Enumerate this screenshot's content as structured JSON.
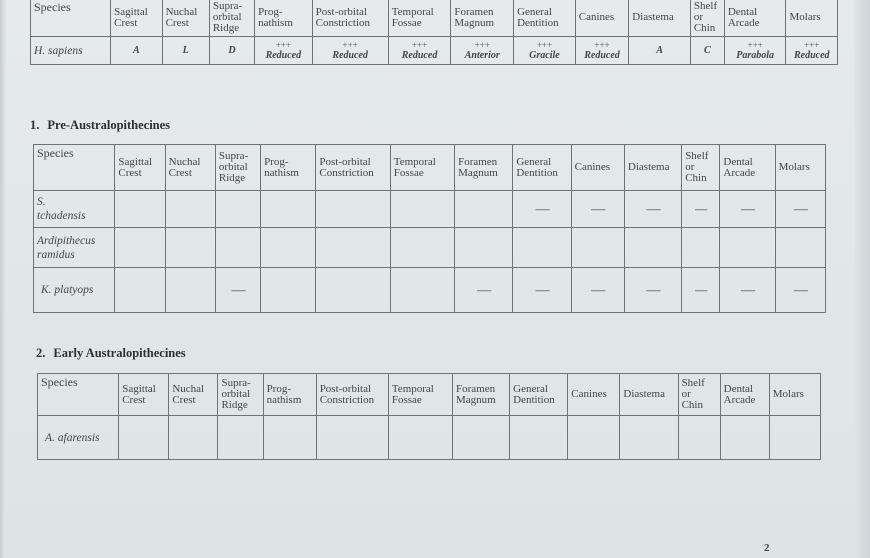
{
  "columns": [
    "Species",
    "Sagittal Crest",
    "Nuchal Crest",
    "Supra-orbital Ridge",
    "Prog-nathism",
    "Post-orbital Constriction",
    "Temporal Fossae",
    "Foramen Magnum",
    "General Dentition",
    "Canines",
    "Diastema",
    "Shelf or Chin",
    "Dental Arcade",
    "Molars"
  ],
  "header_lines": {
    "species": [
      "Species"
    ],
    "sagittal": [
      "Sagittal",
      "Crest"
    ],
    "nuchal": [
      "Nuchal",
      "Crest"
    ],
    "supraorbital": [
      "Supra-",
      "orbital",
      "Ridge"
    ],
    "prognathism": [
      "Prog-",
      "nathism"
    ],
    "postorbital": [
      "Post-orbital",
      "Constriction"
    ],
    "temporal": [
      "Temporal",
      "Fossae"
    ],
    "foramen": [
      "Foramen",
      "Magnum"
    ],
    "dentition": [
      "General",
      "Dentition"
    ],
    "canines": [
      "Canines"
    ],
    "diastema": [
      "Diastema"
    ],
    "shelf": [
      "Shelf",
      "or",
      "Chin"
    ],
    "arcade": [
      "Dental",
      "Arcade"
    ],
    "molars": [
      "Molars"
    ]
  },
  "reference_table": {
    "species": "H. sapiens",
    "cells": [
      {
        "plus": "",
        "value": "A"
      },
      {
        "plus": "",
        "value": "L"
      },
      {
        "plus": "",
        "value": "D"
      },
      {
        "plus": "+++",
        "value": "Reduced"
      },
      {
        "plus": "+++",
        "value": "Reduced"
      },
      {
        "plus": "+++",
        "value": "Reduced"
      },
      {
        "plus": "+++",
        "value": "Anterior"
      },
      {
        "plus": "+++",
        "value": "Gracile"
      },
      {
        "plus": "+++",
        "value": "Reduced"
      },
      {
        "plus": "",
        "value": "A"
      },
      {
        "plus": "",
        "value": "C"
      },
      {
        "plus": "+++",
        "value": "Parabola"
      },
      {
        "plus": "+++",
        "value": "Reduced"
      }
    ]
  },
  "sections": [
    {
      "number": "1.",
      "title": "Pre-Australopithecines",
      "rows": [
        {
          "species_lines": [
            "S.",
            "tchadensis"
          ],
          "cells": [
            "",
            "",
            "",
            "",
            "",
            "",
            "",
            "-------",
            "-------",
            "-------",
            "------",
            "-------",
            "-------"
          ]
        },
        {
          "species_lines": [
            "Ardipithecus",
            "ramidus"
          ],
          "cells": [
            "",
            "",
            "",
            "",
            "",
            "",
            "",
            "",
            "",
            "",
            "",
            "",
            ""
          ]
        },
        {
          "species_lines": [
            "K. platyops"
          ],
          "cells": [
            "",
            "",
            "-------",
            "",
            "",
            "",
            "-------",
            "-------",
            "-------",
            "-------",
            "------",
            "-------",
            "-------"
          ]
        }
      ]
    },
    {
      "number": "2.",
      "title": "Early Australopithecines",
      "rows": [
        {
          "species_lines": [
            "A. afarensis"
          ],
          "cells": [
            "",
            "",
            "",
            "",
            "",
            "",
            "",
            "",
            "",
            "",
            "",
            "",
            ""
          ]
        }
      ]
    }
  ],
  "page_number": "2"
}
